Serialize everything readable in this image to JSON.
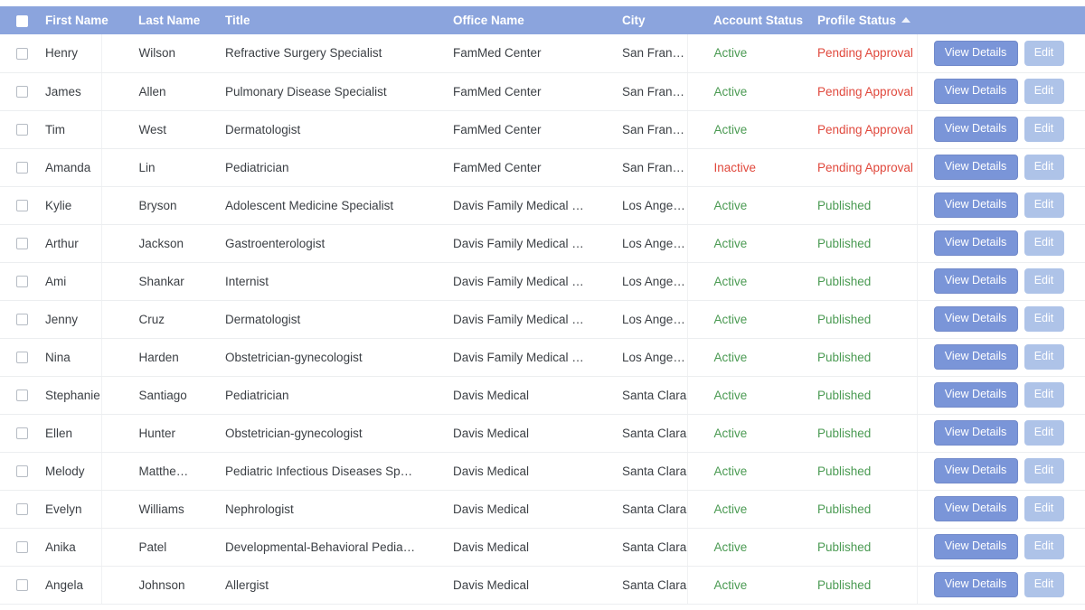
{
  "table": {
    "select_all_label": "",
    "sort": {
      "column": "Profile Status",
      "direction": "asc",
      "arrow": "sort-asc-icon"
    },
    "columns": [
      {
        "key": "check",
        "label": ""
      },
      {
        "key": "first",
        "label": "First Name"
      },
      {
        "key": "last",
        "label": "Last Name"
      },
      {
        "key": "title",
        "label": "Title"
      },
      {
        "key": "office",
        "label": "Office Name"
      },
      {
        "key": "city",
        "label": "City"
      },
      {
        "key": "acct",
        "label": "Account Status"
      },
      {
        "key": "prof",
        "label": "Profile Status"
      },
      {
        "key": "act",
        "label": ""
      }
    ],
    "actions": {
      "view_label": "View Details",
      "edit_label": "Edit"
    },
    "colors": {
      "header_bg": "#8ba4dd",
      "row_bg": "#ffffff",
      "row_border": "#eceef0",
      "status_ok": "#4a9a52",
      "status_warn": "#e0483c",
      "button_primary": "#7a95d8",
      "button_secondary": "#aec3e8",
      "text": "#3b3f44"
    },
    "rows": [
      {
        "first": "Henry",
        "last": "Wilson",
        "title": "Refractive Surgery Specialist",
        "office": "FamMed Center",
        "city": "San Francisco",
        "acct": "Active",
        "acct_state": "active",
        "prof": "Pending Approval",
        "prof_state": "pending"
      },
      {
        "first": "James",
        "last": "Allen",
        "title": "Pulmonary Disease Specialist",
        "office": "FamMed Center",
        "city": "San Francisco",
        "acct": "Active",
        "acct_state": "active",
        "prof": "Pending Approval",
        "prof_state": "pending"
      },
      {
        "first": "Tim",
        "last": "West",
        "title": "Dermatologist",
        "office": "FamMed Center",
        "city": "San Francisco",
        "acct": "Active",
        "acct_state": "active",
        "prof": "Pending Approval",
        "prof_state": "pending"
      },
      {
        "first": "Amanda",
        "last": "Lin",
        "title": "Pediatrician",
        "office": "FamMed Center",
        "city": "San Francisco",
        "acct": "Inactive",
        "acct_state": "inactive",
        "prof": "Pending Approval",
        "prof_state": "pending"
      },
      {
        "first": "Kylie",
        "last": "Bryson",
        "title": "Adolescent Medicine Specialist",
        "office": "Davis Family Medical Group",
        "city": "Los Angeles",
        "acct": "Active",
        "acct_state": "active",
        "prof": "Published",
        "prof_state": "published"
      },
      {
        "first": "Arthur",
        "last": "Jackson",
        "title": "Gastroenterologist",
        "office": "Davis Family Medical Group",
        "city": "Los Angeles",
        "acct": "Active",
        "acct_state": "active",
        "prof": "Published",
        "prof_state": "published"
      },
      {
        "first": "Ami",
        "last": "Shankar",
        "title": "Internist",
        "office": "Davis Family Medical Group",
        "city": "Los Angeles",
        "acct": "Active",
        "acct_state": "active",
        "prof": "Published",
        "prof_state": "published"
      },
      {
        "first": "Jenny",
        "last": "Cruz",
        "title": "Dermatologist",
        "office": "Davis Family Medical Group",
        "city": "Los Angeles",
        "acct": "Active",
        "acct_state": "active",
        "prof": "Published",
        "prof_state": "published"
      },
      {
        "first": "Nina",
        "last": "Harden",
        "title": "Obstetrician-gynecologist",
        "office": "Davis Family Medical Group",
        "city": "Los Angeles",
        "acct": "Active",
        "acct_state": "active",
        "prof": "Published",
        "prof_state": "published"
      },
      {
        "first": "Stephanie",
        "last": "Santiago",
        "title": "Pediatrician",
        "office": "Davis Medical",
        "city": "Santa Clara",
        "acct": "Active",
        "acct_state": "active",
        "prof": "Published",
        "prof_state": "published"
      },
      {
        "first": "Ellen",
        "last": "Hunter",
        "title": "Obstetrician-gynecologist",
        "office": "Davis Medical",
        "city": "Santa Clara",
        "acct": "Active",
        "acct_state": "active",
        "prof": "Published",
        "prof_state": "published"
      },
      {
        "first": "Melody",
        "last": "Matthews",
        "title": "Pediatric Infectious Diseases Specialist",
        "office": "Davis Medical",
        "city": "Santa Clara",
        "acct": "Active",
        "acct_state": "active",
        "prof": "Published",
        "prof_state": "published"
      },
      {
        "first": "Evelyn",
        "last": "Williams",
        "title": "Nephrologist",
        "office": "Davis Medical",
        "city": "Santa Clara",
        "acct": "Active",
        "acct_state": "active",
        "prof": "Published",
        "prof_state": "published"
      },
      {
        "first": "Anika",
        "last": "Patel",
        "title": "Developmental-Behavioral Pediatrician",
        "office": "Davis Medical",
        "city": "Santa Clara",
        "acct": "Active",
        "acct_state": "active",
        "prof": "Published",
        "prof_state": "published"
      },
      {
        "first": "Angela",
        "last": "Johnson",
        "title": "Allergist",
        "office": "Davis Medical",
        "city": "Santa Clara",
        "acct": "Active",
        "acct_state": "active",
        "prof": "Published",
        "prof_state": "published"
      }
    ]
  }
}
